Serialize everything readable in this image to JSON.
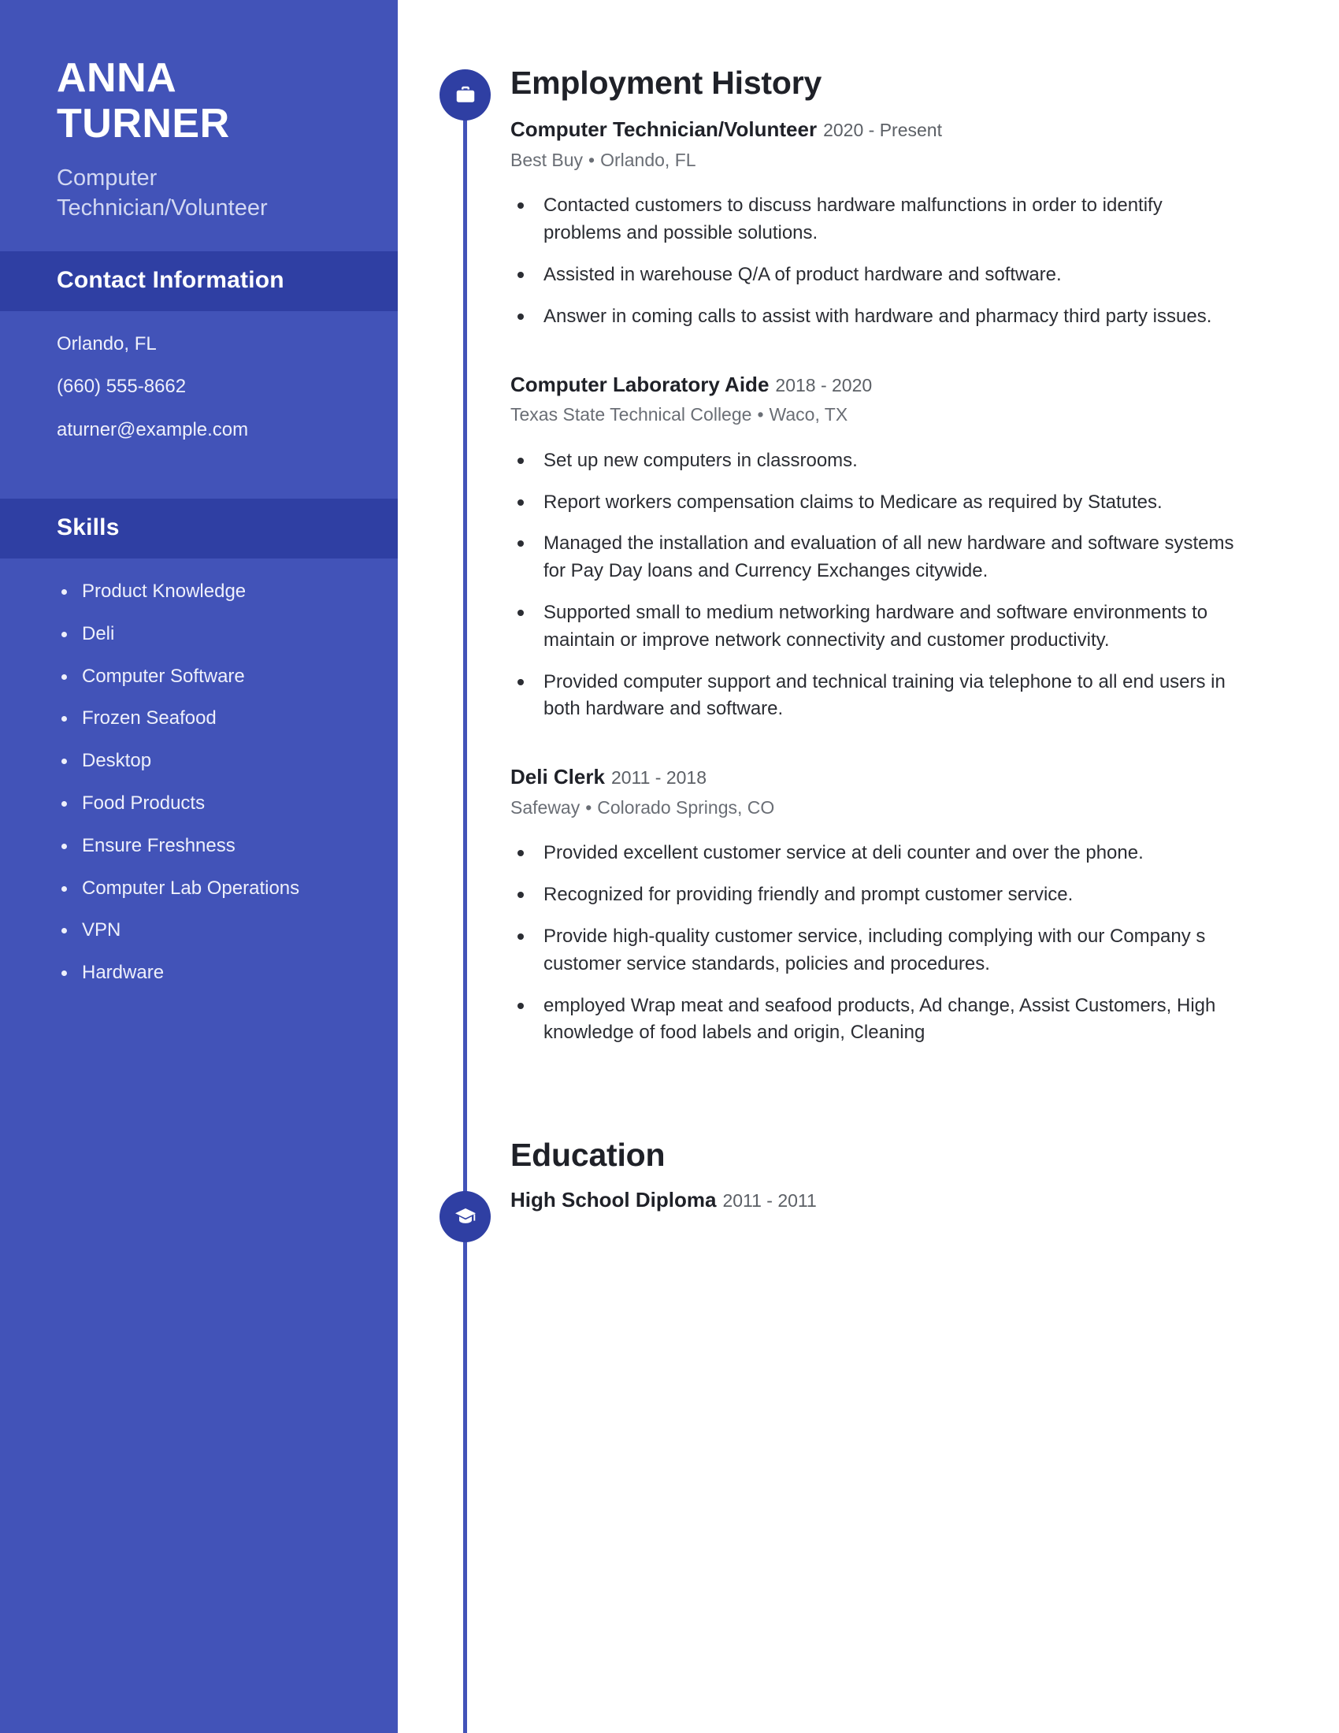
{
  "theme": {
    "sidebar_bg": "#4253B8",
    "sidebar_band_bg": "#2F3FA3",
    "accent": "#2F3FA3",
    "text_dark": "#1F2128",
    "text_muted": "#6A6E75"
  },
  "sidebar": {
    "first_name": "ANNA",
    "last_name": "TURNER",
    "headline": "Computer Technician/Volunteer",
    "contact_section": {
      "title": "Contact Information",
      "lines": [
        "Orlando, FL",
        "(660) 555-8662",
        "aturner@example.com"
      ]
    },
    "skills_section": {
      "title": "Skills",
      "items": [
        "Product Knowledge",
        "Deli",
        "Computer Software",
        "Frozen Seafood",
        "Desktop",
        "Food Products",
        "Ensure Freshness",
        "Computer Lab Operations",
        "VPN",
        "Hardware"
      ]
    }
  },
  "main": {
    "employment": {
      "icon": "briefcase-icon",
      "title": "Employment History",
      "jobs": [
        {
          "title": "Computer Technician/Volunteer",
          "dates": "2020 - Present",
          "company": "Best Buy",
          "separator": "•",
          "location": "Orlando, FL",
          "duties": [
            "Contacted customers to discuss hardware malfunctions in order to identify problems and possible solutions.",
            "Assisted in warehouse Q/A of product hardware and software.",
            "Answer in coming calls to assist with hardware and pharmacy third party issues."
          ]
        },
        {
          "title": "Computer Laboratory Aide",
          "dates": "2018 - 2020",
          "company": "Texas State Technical College",
          "separator": "•",
          "location": "Waco, TX",
          "duties": [
            "Set up new computers in classrooms.",
            "Report workers compensation claims to Medicare as required by Statutes.",
            "Managed the installation and evaluation of all new hardware and software systems for Pay Day loans and Currency Exchanges citywide.",
            "Supported small to medium networking hardware and software environments to maintain or improve network connectivity and customer productivity.",
            "Provided computer support and technical training via telephone to all end users in both hardware and software."
          ]
        },
        {
          "title": "Deli Clerk",
          "dates": "2011 - 2018",
          "company": "Safeway",
          "separator": "•",
          "location": "Colorado Springs, CO",
          "duties": [
            "Provided excellent customer service at deli counter and over the phone.",
            "Recognized for providing friendly and prompt customer service.",
            "Provide high-quality customer service, including complying with our Company s customer service standards, policies and procedures.",
            "employed Wrap meat and seafood products, Ad change, Assist Customers, High knowledge of food labels and origin, Cleaning"
          ]
        }
      ]
    },
    "education": {
      "icon": "graduation-cap-icon",
      "title": "Education",
      "entries": [
        {
          "degree": "High School Diploma",
          "dates": "2011 - 2011"
        }
      ]
    }
  }
}
